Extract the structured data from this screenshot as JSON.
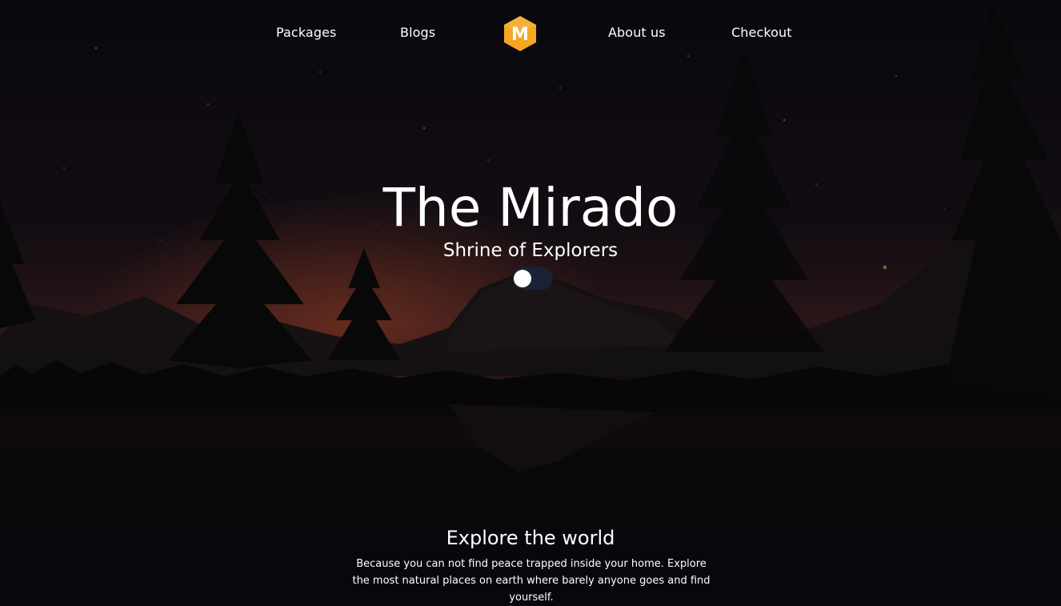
{
  "nav": {
    "links_left": [
      "Packages",
      "Blogs"
    ],
    "links_right": [
      "About us",
      "Checkout"
    ],
    "logo_letter": "M",
    "logo_color": "#f5a623"
  },
  "hero": {
    "title": "The Mirado",
    "subtitle": "Shrine of Explorers",
    "toggle_on": false
  },
  "explore": {
    "heading": "Explore the world",
    "body": "Because you can not find peace trapped inside your home. Explore the most natural places on earth where barely anyone goes and find yourself."
  },
  "colors": {
    "background": "#07080c",
    "text": "#ffffff",
    "toggle_track": "#1c2236"
  }
}
